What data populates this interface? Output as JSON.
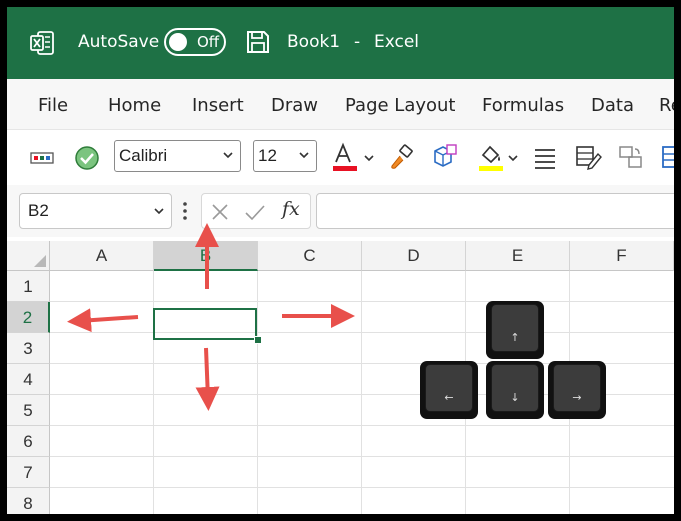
{
  "titlebar": {
    "autosave_label": "AutoSave",
    "autosave_state": "Off",
    "book_name": "Book1",
    "separator": "-",
    "app_name": "Excel"
  },
  "menu": [
    "File",
    "Home",
    "Insert",
    "Draw",
    "Page Layout",
    "Formulas",
    "Data",
    "Re"
  ],
  "ribbon": {
    "font_name": "Calibri",
    "font_size": "12",
    "font_color": "#e81123",
    "highlight_color": "#ffff00"
  },
  "formula_bar": {
    "name_box": "B2",
    "formula": "",
    "fx_label": "fx"
  },
  "grid": {
    "columns": [
      "A",
      "B",
      "C",
      "D",
      "E",
      "F"
    ],
    "rows": [
      "1",
      "2",
      "3",
      "4",
      "5",
      "6",
      "7",
      "8"
    ],
    "selected_cell": "B2"
  },
  "keys": {
    "up": "↑",
    "left": "←",
    "down": "↓",
    "right": "→"
  },
  "annotation_arrow_color": "#e8504b",
  "brand_color": "#1e7145"
}
